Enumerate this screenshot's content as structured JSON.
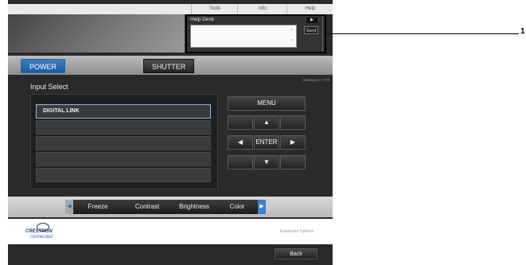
{
  "top_tabs": [
    "Tools",
    "Info",
    "Help"
  ],
  "help_desk": {
    "title": "Help Desk",
    "send_label": "Send"
  },
  "buttons": {
    "power": "POWER",
    "shutter": "SHUTTER",
    "menu": "MENU",
    "enter": "ENTER",
    "back": "Back"
  },
  "interface_version": "Interface 2.7.3 N",
  "input_select": {
    "title": "Input Select",
    "items": [
      "DIGITAL LINK"
    ]
  },
  "bottom_controls": [
    "Freeze",
    "Contrast",
    "Brightness",
    "Color"
  ],
  "footer": {
    "brand": "CRESTRON",
    "brand_sub": "connected",
    "expansion": "Expansion Options"
  },
  "callout": "1",
  "colors": {
    "accent_blue": "#1e5aa0",
    "panel_dark": "#2a2a2a"
  },
  "icons": {
    "up": "arrow-up",
    "down": "arrow-down",
    "left": "arrow-left",
    "right": "arrow-right"
  }
}
